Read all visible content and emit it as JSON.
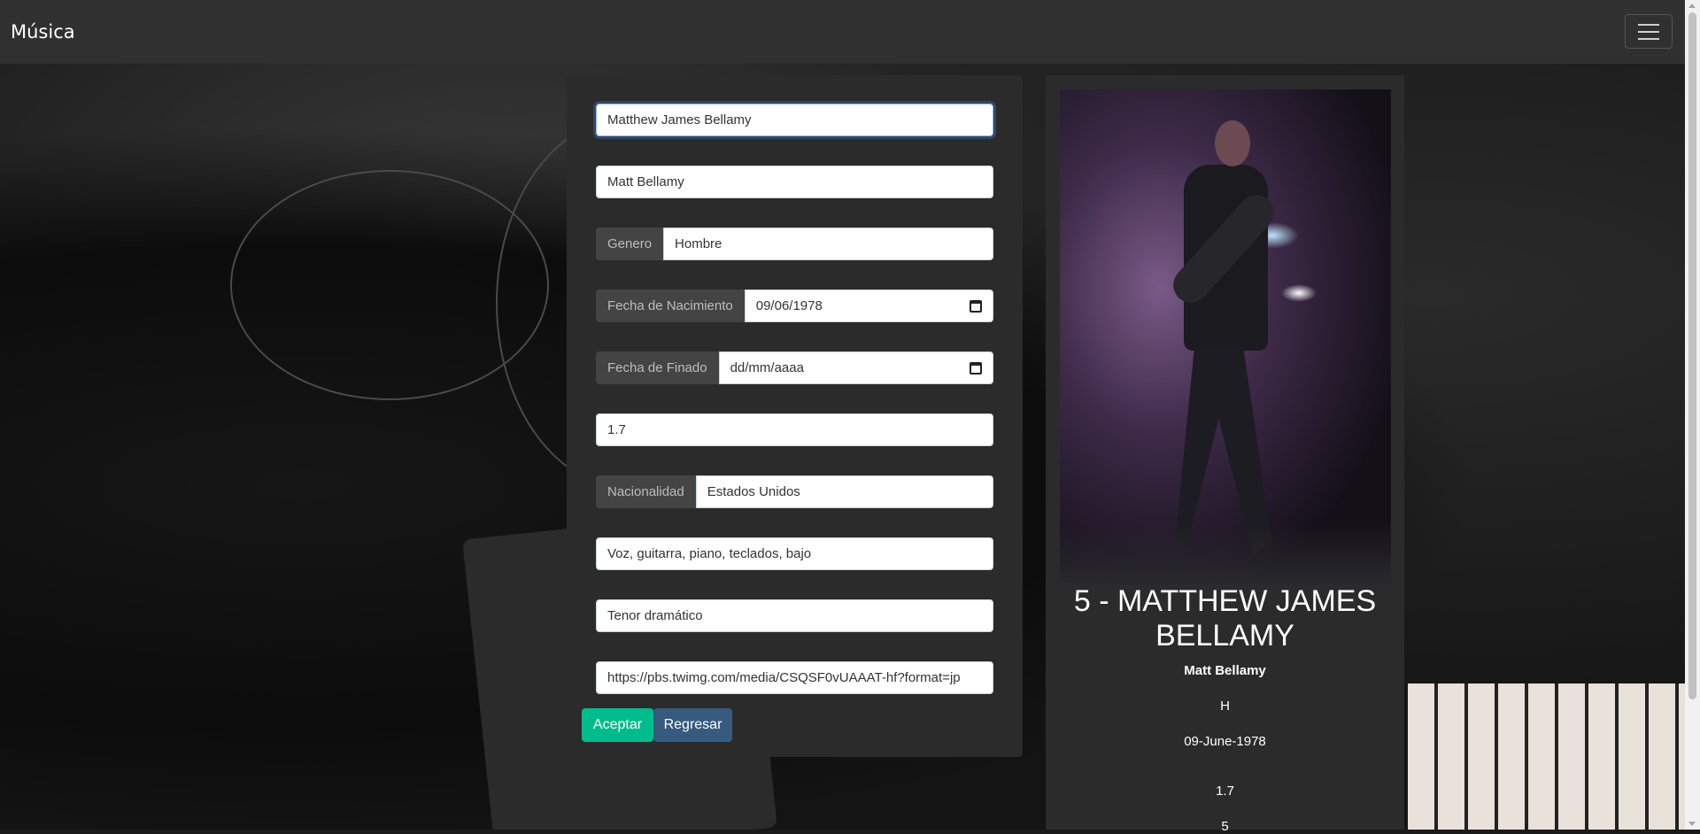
{
  "navbar": {
    "brand": "Música"
  },
  "form": {
    "nombre": "Matthew James Bellamy",
    "nombre_artistico": "Matt Bellamy",
    "genero_label": "Genero",
    "genero_value": "Hombre",
    "nacimiento_label": "Fecha de Nacimiento",
    "nacimiento_value": "09/06/1978",
    "finado_label": "Fecha de Finado",
    "finado_placeholder": "dd/mm/aaaa",
    "estatura": "1.7",
    "nacionalidad_label": "Nacionalidad",
    "nacionalidad_value": "Estados Unidos",
    "instrumentos": "Voz, guitarra, piano, teclados, bajo",
    "tesitura": "Tenor dramático",
    "imagen_url": "https://pbs.twimg.com/media/CSQSF0vUAAAT-hf?format=jp",
    "accept_label": "Aceptar",
    "back_label": "Regresar"
  },
  "detail": {
    "title_line1": "5 - MATTHEW JAMES",
    "title_line2": "BELLAMY",
    "alias": "Matt Bellamy",
    "genero": "H",
    "fecha": "09-June-1978",
    "estatura": "1.7",
    "extra": "5"
  }
}
